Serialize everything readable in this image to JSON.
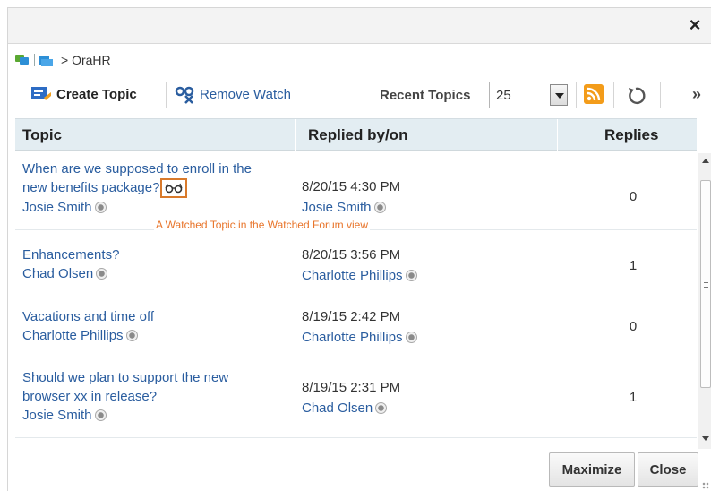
{
  "window": {
    "close_label": "×"
  },
  "breadcrumb": {
    "text": "> OraHR"
  },
  "toolbar": {
    "create_topic": "Create Topic",
    "remove_watch": "Remove Watch",
    "recent_topics_label": "Recent Topics",
    "recent_topics_value": "25",
    "more": "»"
  },
  "table": {
    "headers": {
      "topic": "Topic",
      "replied": "Replied by/on",
      "replies": "Replies"
    },
    "rows": [
      {
        "topic_line1": "When are we supposed to enroll in the",
        "topic_line2": "new benefits package?",
        "author": "Josie Smith",
        "date": "8/20/15 4:30 PM",
        "replied_by": "Josie Smith",
        "replies": "0"
      },
      {
        "topic_line1": "Enhancements?",
        "author": "Chad Olsen",
        "date": "8/20/15 3:56 PM",
        "replied_by": "Charlotte Phillips",
        "replies": "1"
      },
      {
        "topic_line1": "Vacations and time off",
        "author": "Charlotte Phillips",
        "date": "8/19/15 2:42 PM",
        "replied_by": "Charlotte Phillips",
        "replies": "0"
      },
      {
        "topic_line1": "Should we plan to support the new",
        "topic_line2": "browser xx in release?",
        "author": "Josie Smith",
        "date": "8/19/15 2:31 PM",
        "replied_by": "Chad Olsen",
        "replies": "1"
      }
    ]
  },
  "callout": "A Watched Topic in the Watched Forum view",
  "footer": {
    "maximize": "Maximize",
    "close": "Close"
  },
  "colors": {
    "link": "#2a5d9f",
    "header_bg": "#e3edf2",
    "callout": "#e8742a",
    "rss": "#f39c1a"
  }
}
